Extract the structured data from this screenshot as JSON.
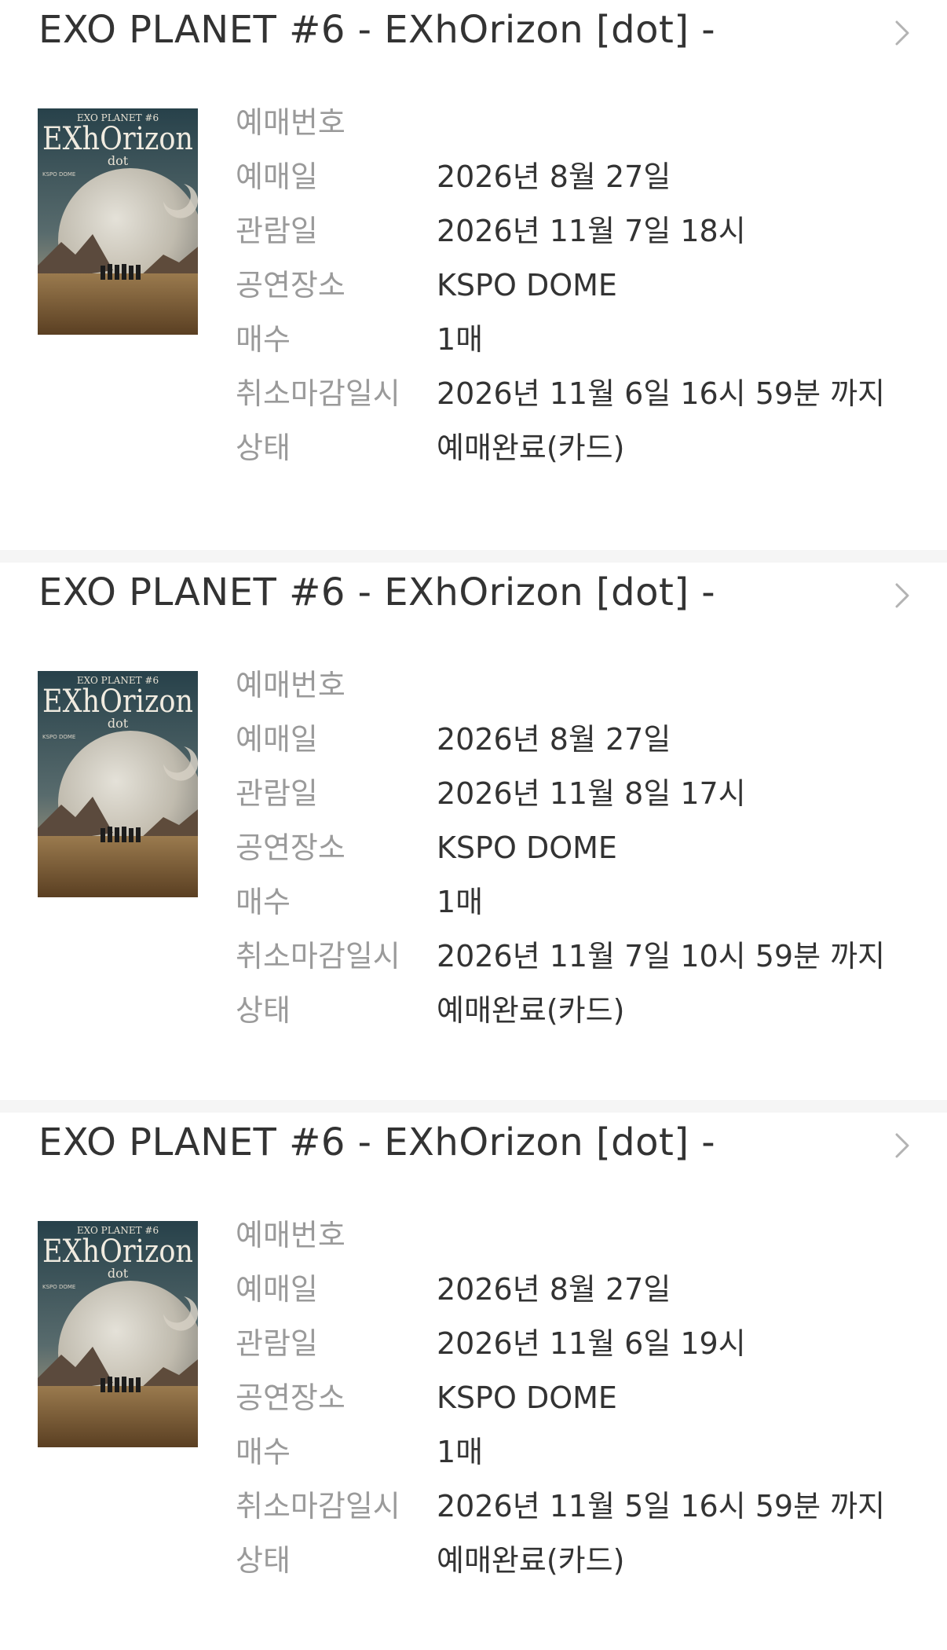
{
  "colors": {
    "title": "#333333",
    "label": "#9a9a9a",
    "value": "#333333",
    "divider": "#f5f5f5",
    "chevron": "#b3b3b3"
  },
  "bookings": [
    {
      "title": "EXO PLANET #6 - EXhOrizon [dot] -",
      "chevron_icon": "chevron-right-icon",
      "poster": {
        "top_text": "EXO PLANET #6",
        "logo_text": "EXhOrizon",
        "sub_text": "dot",
        "venue_text": "KSPO DOME"
      },
      "rows": [
        {
          "label": "예매번호",
          "value": ""
        },
        {
          "label": "예매일",
          "value": "2026년 8월 27일"
        },
        {
          "label": "관람일",
          "value": "2026년 11월 7일 18시"
        },
        {
          "label": "공연장소",
          "value": "KSPO DOME"
        },
        {
          "label": "매수",
          "value": "1매"
        },
        {
          "label": "취소마감일시",
          "value": "2026년 11월 6일 16시 59분 까지"
        },
        {
          "label": "상태",
          "value": "예매완료(카드)"
        }
      ]
    },
    {
      "title": "EXO PLANET #6 - EXhOrizon [dot] -",
      "chevron_icon": "chevron-right-icon",
      "poster": {
        "top_text": "EXO PLANET #6",
        "logo_text": "EXhOrizon",
        "sub_text": "dot",
        "venue_text": "KSPO DOME"
      },
      "rows": [
        {
          "label": "예매번호",
          "value": ""
        },
        {
          "label": "예매일",
          "value": "2026년 8월 27일"
        },
        {
          "label": "관람일",
          "value": "2026년 11월 8일 17시"
        },
        {
          "label": "공연장소",
          "value": "KSPO DOME"
        },
        {
          "label": "매수",
          "value": "1매"
        },
        {
          "label": "취소마감일시",
          "value": "2026년 11월 7일 10시 59분 까지"
        },
        {
          "label": "상태",
          "value": "예매완료(카드)"
        }
      ]
    },
    {
      "title": "EXO PLANET #6 - EXhOrizon [dot] -",
      "chevron_icon": "chevron-right-icon",
      "poster": {
        "top_text": "EXO PLANET #6",
        "logo_text": "EXhOrizon",
        "sub_text": "dot",
        "venue_text": "KSPO DOME"
      },
      "rows": [
        {
          "label": "예매번호",
          "value": ""
        },
        {
          "label": "예매일",
          "value": "2026년 8월 27일"
        },
        {
          "label": "관람일",
          "value": "2026년 11월 6일 19시"
        },
        {
          "label": "공연장소",
          "value": "KSPO DOME"
        },
        {
          "label": "매수",
          "value": "1매"
        },
        {
          "label": "취소마감일시",
          "value": "2026년 11월 5일 16시 59분 까지"
        },
        {
          "label": "상태",
          "value": "예매완료(카드)"
        }
      ]
    }
  ]
}
